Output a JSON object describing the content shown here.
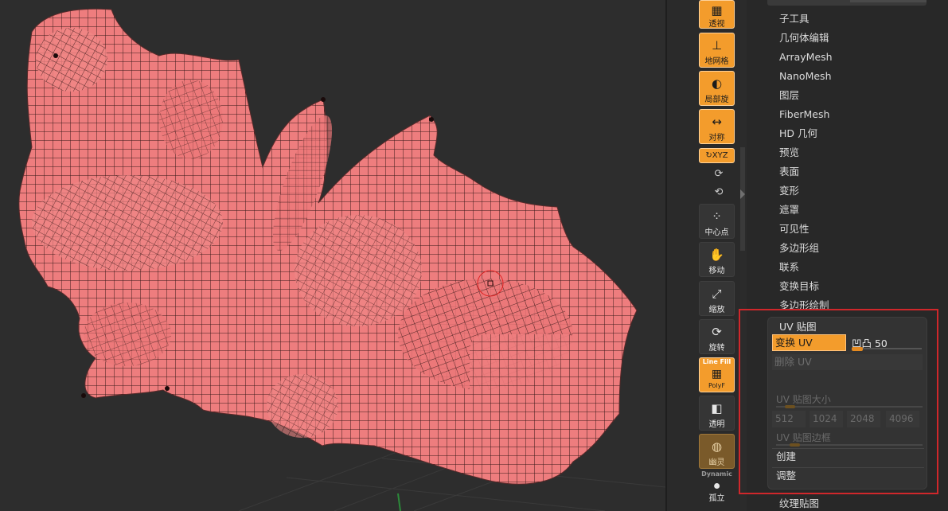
{
  "shelf": {
    "perspective": "透视",
    "floor": "地网格",
    "local": "局部旋",
    "symmetry": "对称",
    "xyz": "XYZ",
    "center": "中心点",
    "move": "移动",
    "scale": "缩放",
    "rotate": "旋转",
    "linefill_top": "Line Fill",
    "linefill_bottom": "PolyF",
    "transparent": "透明",
    "ghost": "幽灵",
    "dynamic": "Dynamic",
    "solo": "孤立"
  },
  "menu": {
    "items": [
      "子工具",
      "几何体编辑",
      "ArrayMesh",
      "NanoMesh",
      "图层",
      "FiberMesh",
      "HD 几何",
      "预览",
      "表面",
      "变形",
      "遮罩",
      "可见性",
      "多边形组",
      "联系",
      "变换目标",
      "多边形绘制"
    ],
    "bottom": "纹理贴图"
  },
  "uv": {
    "title": "UV 贴图",
    "flip": "变换 UV",
    "bump_label": "凹凸 50",
    "bump_value": 50,
    "delete": "删除 UV",
    "map_size_label": "UV 贴图大小",
    "sizes": [
      "512",
      "1024",
      "2048",
      "4096"
    ],
    "border_label": "UV 贴图边框",
    "create": "创建",
    "adjust": "调整"
  },
  "colors": {
    "accent": "#f39c2c",
    "mesh": "#ee7d7e",
    "highlight": "#d0272b"
  },
  "icons": [
    "perspective-icon",
    "floor-grid-icon",
    "local-icon",
    "symmetry-icon",
    "xyz-icon",
    "rotate-small-icon",
    "center-icon",
    "move-hand-icon",
    "scale-icon",
    "rotate-icon",
    "linefill-grid-icon",
    "transparent-icon",
    "ghost-icon",
    "solo-icon"
  ]
}
